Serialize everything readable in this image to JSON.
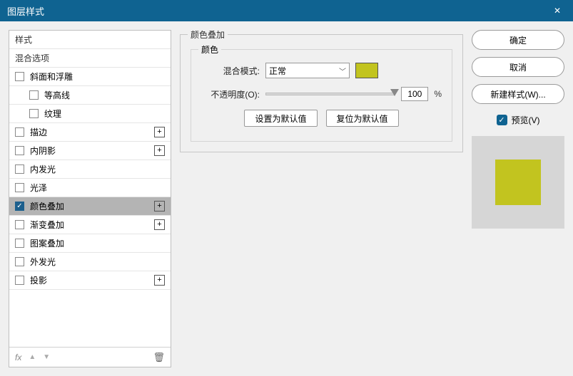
{
  "titlebar": {
    "title": "图层样式",
    "close": "✕"
  },
  "left": {
    "header_styles": "样式",
    "header_blend": "混合选项",
    "items": [
      {
        "label": "斜面和浮雕",
        "checked": false,
        "expandable": false
      },
      {
        "label": "等高线",
        "checked": false,
        "indent": true
      },
      {
        "label": "纹理",
        "checked": false,
        "indent": true
      },
      {
        "label": "描边",
        "checked": false,
        "expandable": true
      },
      {
        "label": "内阴影",
        "checked": false,
        "expandable": true
      },
      {
        "label": "内发光",
        "checked": false
      },
      {
        "label": "光泽",
        "checked": false
      },
      {
        "label": "颜色叠加",
        "checked": true,
        "selected": true,
        "expandable": true
      },
      {
        "label": "渐变叠加",
        "checked": false,
        "expandable": true
      },
      {
        "label": "图案叠加",
        "checked": false
      },
      {
        "label": "外发光",
        "checked": false
      },
      {
        "label": "投影",
        "checked": false,
        "expandable": true
      }
    ],
    "footer": {
      "fx": "fx",
      "up": "▲",
      "down": "▼",
      "trash": "🗑"
    }
  },
  "main": {
    "group_title": "颜色叠加",
    "color_group": "颜色",
    "blend_mode_label": "混合模式:",
    "blend_mode_value": "正常",
    "opacity_label": "不透明度(O):",
    "opacity_value": "100",
    "opacity_unit": "%",
    "swatch_color": "#c2c41f",
    "btn_default": "设置为默认值",
    "btn_reset": "复位为默认值"
  },
  "right": {
    "ok": "确定",
    "cancel": "取消",
    "new_style": "新建样式(W)...",
    "preview_label": "预览(V)",
    "preview_color": "#c2c41f"
  }
}
